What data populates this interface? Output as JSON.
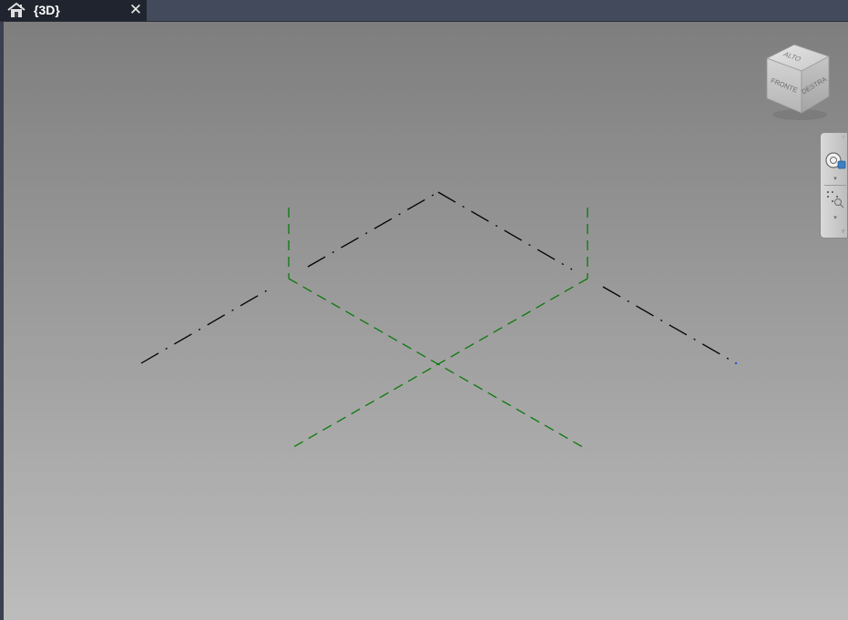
{
  "tab": {
    "title": "{3D}",
    "close_symbol": "✕",
    "home_icon": "home-icon"
  },
  "viewcube": {
    "faces": {
      "top": "ALTO",
      "front": "FRONTE",
      "right": "DESTRA"
    }
  },
  "navbar": {
    "steering_wheel_icon": "steering-wheel-icon",
    "zoom_icon": "zoom-icon",
    "dropdown_symbol": "▾"
  },
  "colors": {
    "viewport_top": "#7e7e7e",
    "viewport_bottom": "#bcbcbc",
    "black_lines": "#000000",
    "green_lines": "#0a7a0a",
    "tab_active": "#20242e",
    "tab_bar": "#424a5c"
  }
}
